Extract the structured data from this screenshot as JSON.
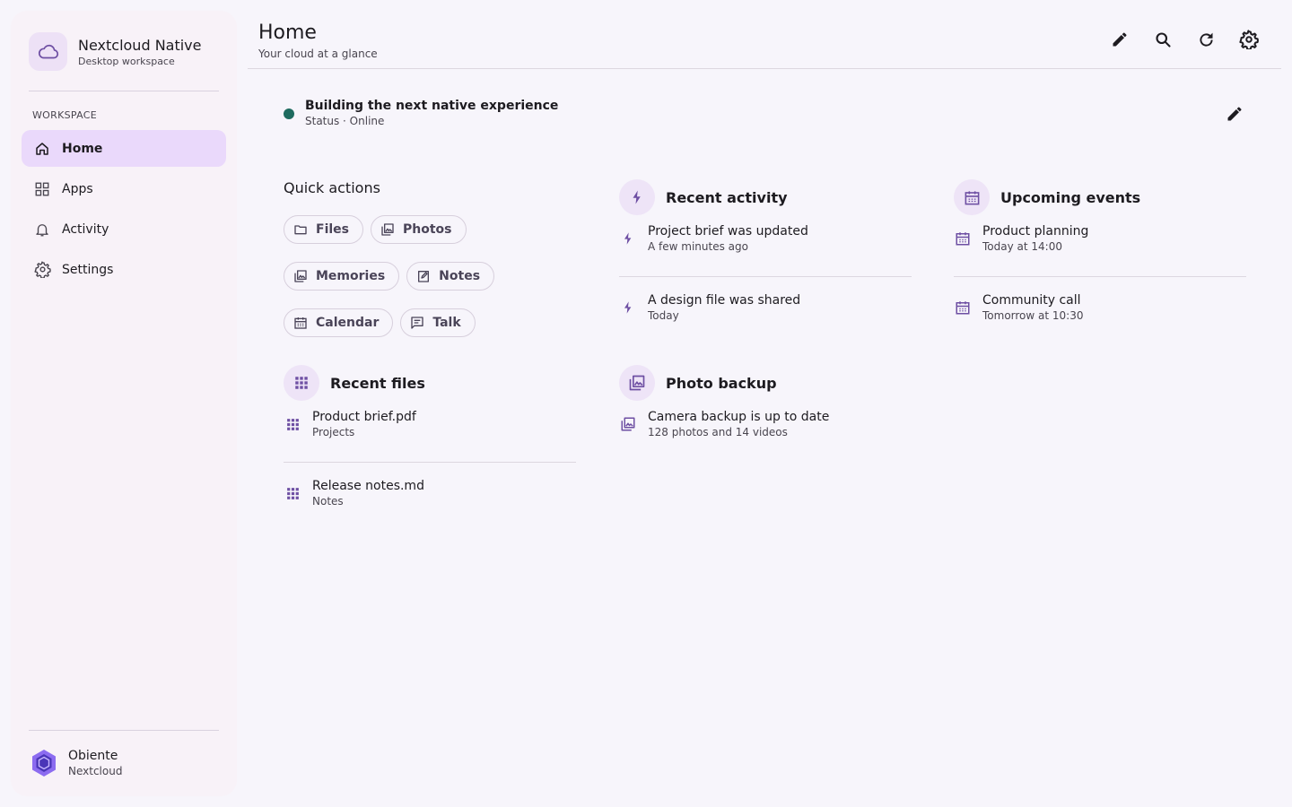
{
  "brand": {
    "title": "Nextcloud Native",
    "subtitle": "Desktop workspace",
    "icon": "cloud-icon"
  },
  "sidebar": {
    "section_label": "WORKSPACE",
    "items": [
      {
        "label": "Home",
        "icon": "home-icon",
        "active": true
      },
      {
        "label": "Apps",
        "icon": "apps-grid-icon",
        "active": false
      },
      {
        "label": "Activity",
        "icon": "bell-icon",
        "active": false
      },
      {
        "label": "Settings",
        "icon": "gear-icon",
        "active": false
      }
    ]
  },
  "account": {
    "name": "Obiente",
    "server": "Nextcloud",
    "icon": "hexagon-avatar-icon"
  },
  "header": {
    "title": "Home",
    "subtitle": "Your cloud at a glance",
    "actions": [
      "edit-icon",
      "search-icon",
      "refresh-icon",
      "gear-icon"
    ]
  },
  "status": {
    "message": "Building the next native experience",
    "detail": "Status · Online",
    "color": "#1e6b5f"
  },
  "quick_actions": {
    "title": "Quick actions",
    "chips": [
      {
        "label": "Files",
        "icon": "folder-icon"
      },
      {
        "label": "Photos",
        "icon": "photos-icon"
      },
      {
        "label": "Memories",
        "icon": "photos-icon"
      },
      {
        "label": "Notes",
        "icon": "notes-icon"
      },
      {
        "label": "Calendar",
        "icon": "calendar-icon"
      },
      {
        "label": "Talk",
        "icon": "chat-icon"
      }
    ]
  },
  "cards": {
    "recent_activity": {
      "title": "Recent activity",
      "icon": "bolt-icon",
      "items": [
        {
          "title": "Project brief was updated",
          "subtitle": "A few minutes ago"
        },
        {
          "title": "A design file was shared",
          "subtitle": "Today"
        }
      ]
    },
    "upcoming_events": {
      "title": "Upcoming events",
      "icon": "calendar-icon",
      "items": [
        {
          "title": "Product planning",
          "subtitle": "Today at 14:00"
        },
        {
          "title": "Community call",
          "subtitle": "Tomorrow at 10:30"
        }
      ]
    },
    "recent_files": {
      "title": "Recent files",
      "icon": "apps-dots-icon",
      "items": [
        {
          "title": "Product brief.pdf",
          "subtitle": "Projects"
        },
        {
          "title": "Release notes.md",
          "subtitle": "Notes"
        }
      ]
    },
    "photo_backup": {
      "title": "Photo backup",
      "icon": "photos-icon",
      "items": [
        {
          "title": "Camera backup is up to date",
          "subtitle": "128 photos and 14 videos"
        }
      ]
    }
  },
  "colors": {
    "accent": "#6e4fa3",
    "active_nav": "#ead9fb",
    "icon_circle": "#eee4f7",
    "background": "#f7f5fb"
  }
}
